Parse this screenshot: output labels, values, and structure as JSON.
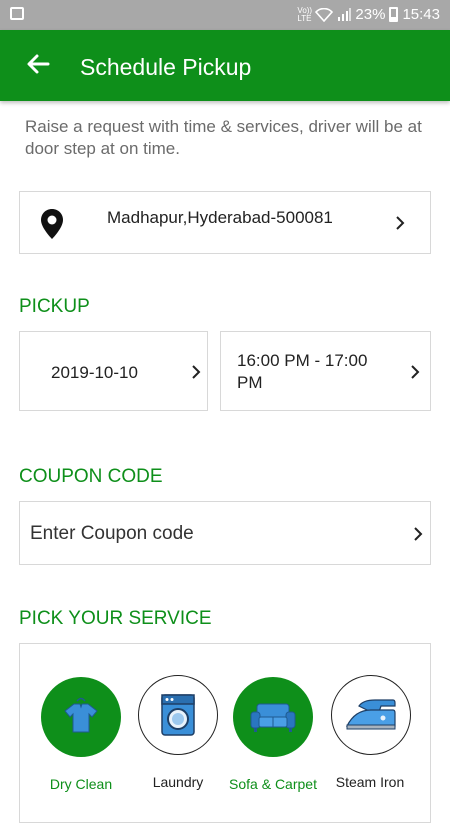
{
  "status_bar": {
    "volte": "Vo)) LTE",
    "battery_percent": "23%",
    "time": "15:43"
  },
  "app_bar": {
    "title": "Schedule Pickup"
  },
  "intro_text": "Raise a request with time & services,  driver will be at door step at on time.",
  "location": {
    "address": "Madhapur,Hyderabad-500081"
  },
  "pickup": {
    "heading": "PICKUP",
    "date": "2019-10-10",
    "time_slot": "16:00 PM - 17:00 PM"
  },
  "coupon": {
    "heading": "COUPON CODE",
    "placeholder": "Enter Coupon code"
  },
  "services": {
    "heading": "PICK YOUR SERVICE",
    "items": [
      {
        "label": "Dry Clean",
        "icon": "shirt-icon",
        "selected": true
      },
      {
        "label": "Laundry",
        "icon": "washing-machine-icon",
        "selected": false
      },
      {
        "label": "Sofa & Carpet",
        "icon": "sofa-icon",
        "selected": true
      },
      {
        "label": "Steam Iron",
        "icon": "iron-icon",
        "selected": false
      }
    ]
  },
  "colors": {
    "primary": "#0e8f1a",
    "status_bar": "#a8a8a8",
    "icon_blue": "#3a8fd8"
  }
}
